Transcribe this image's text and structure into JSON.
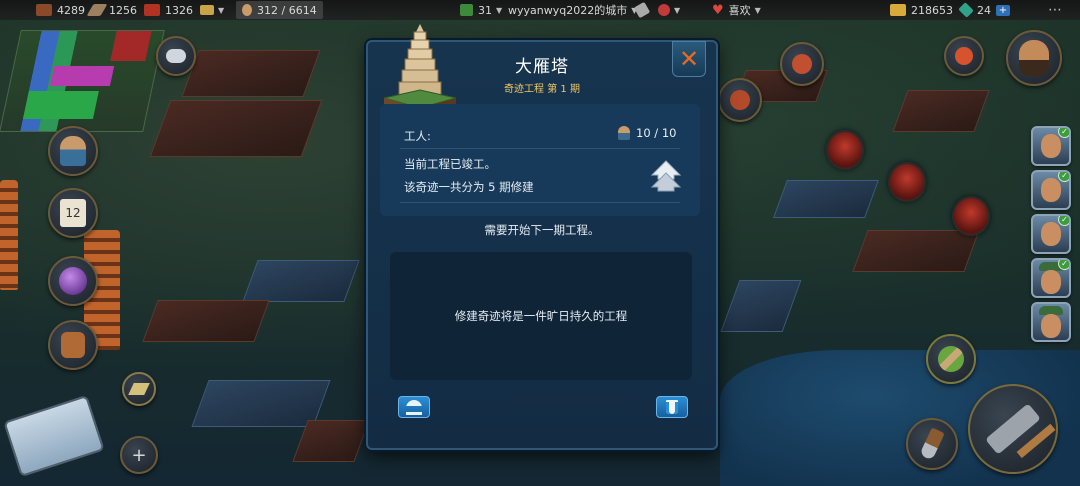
{
  "topbar": {
    "food": "4289",
    "wood": "1256",
    "brick": "1326",
    "citizens": "312 / 6614",
    "level": "31",
    "city_name": "wyyanwyq2022的城市",
    "mood": "喜欢",
    "gold": "218653",
    "gems": "24",
    "gems_plus": "+",
    "menu": "⋯"
  },
  "panel": {
    "title": "大雁塔",
    "subtitle": "奇迹工程 第 1 期",
    "close_icon": "close-x-icon",
    "workers_label": "工人:",
    "workers_value": "10 / 10",
    "status_line1": "当前工程已竣工。",
    "status_line2": "该奇迹一共分为 5 期修建",
    "next_phase_note": "需要开始下一期工程。",
    "description": "修建奇迹将是一件旷日持久的工程"
  },
  "side": {
    "badge_number": "12",
    "add_symbol": "+"
  },
  "colors": {
    "panel_bg": "#17344f",
    "accent_gold": "#f0c862",
    "close_orange": "#e86a24",
    "button_blue": "#2b8fd6"
  }
}
